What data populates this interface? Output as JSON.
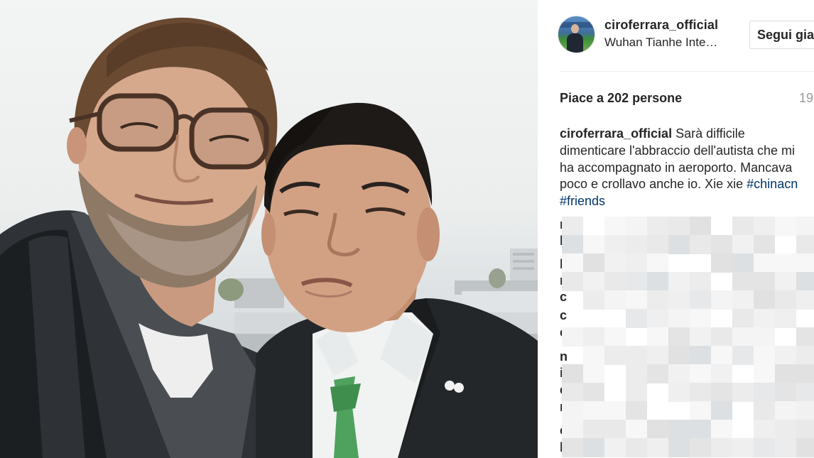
{
  "post": {
    "username": "ciroferrara_official",
    "location": "Wuhan Tianhe Inte…",
    "follow_label": "Segui gia",
    "likes": "Piace a 202 persone",
    "time_ago": "19",
    "caption": {
      "username": "ciroferrara_official",
      "text": " Sarà difficile dimenticare l'abbraccio dell'autista che mi ha accompagnato in aeroporto. Mancava poco e crollavo anche io. Xie xie ",
      "hashtags": [
        "#chinacn",
        "#friends"
      ]
    }
  },
  "comments": {
    "initials": [
      "n",
      "l",
      "b",
      "n",
      "c",
      "c",
      "c",
      "n",
      "i",
      "e",
      "n",
      "c",
      "l"
    ]
  },
  "colors": {
    "text": "#262626",
    "hashtag": "#003569",
    "muted": "#999999",
    "border": "#dbdbdb"
  },
  "icons": [
    "avatar-photo"
  ]
}
